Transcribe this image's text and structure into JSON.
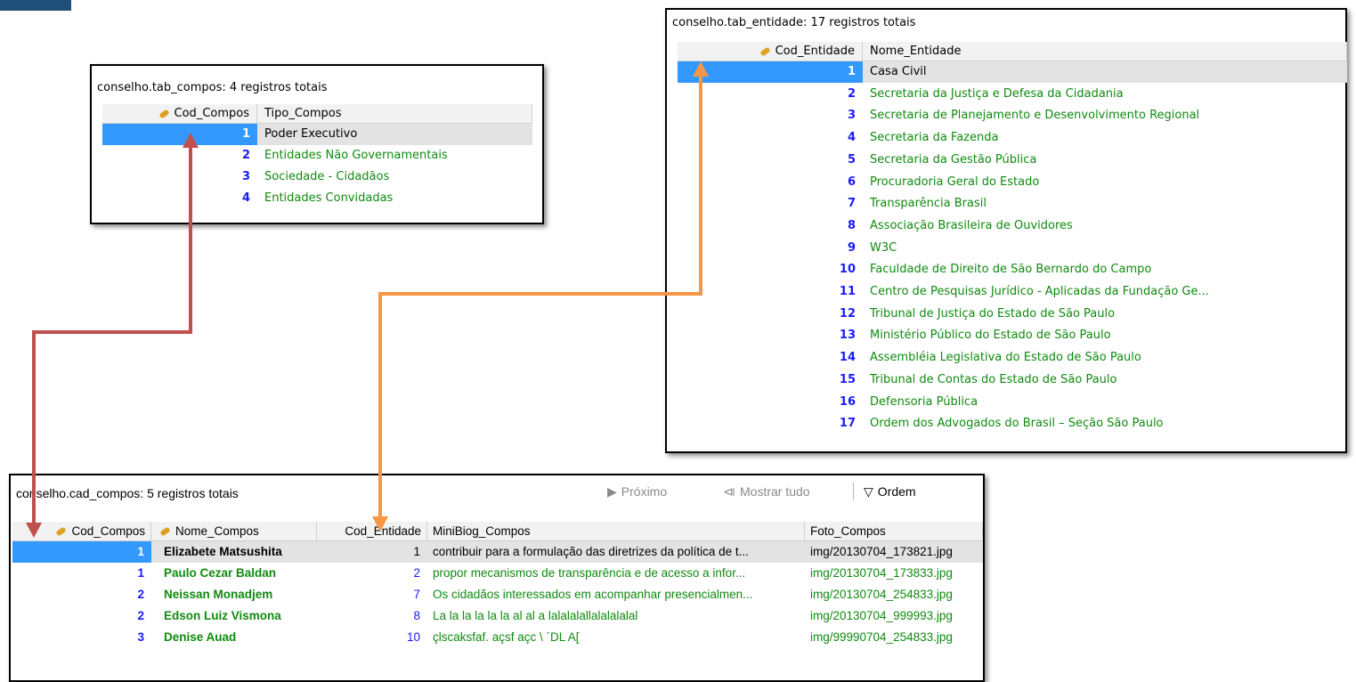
{
  "compos_table": {
    "title": "conselho.tab_compos: 4 registros totais",
    "columns": [
      "Cod_Compos",
      "Tipo_Compos"
    ],
    "rows": [
      {
        "cod": "1",
        "tipo": "Poder Executivo"
      },
      {
        "cod": "2",
        "tipo": "Entidades Não Governamentais"
      },
      {
        "cod": "3",
        "tipo": "Sociedade - Cidadãos"
      },
      {
        "cod": "4",
        "tipo": "Entidades Convidadas"
      }
    ]
  },
  "entidade_table": {
    "title": "conselho.tab_entidade: 17 registros totais",
    "columns": [
      "Cod_Entidade",
      "Nome_Entidade"
    ],
    "rows": [
      {
        "cod": "1",
        "nome": "Casa Civil"
      },
      {
        "cod": "2",
        "nome": "Secretaria da Justiça e Defesa da Cidadania"
      },
      {
        "cod": "3",
        "nome": "Secretaria de Planejamento e Desenvolvimento Regional"
      },
      {
        "cod": "4",
        "nome": "Secretaria da Fazenda"
      },
      {
        "cod": "5",
        "nome": "Secretaria da Gestão Pública"
      },
      {
        "cod": "6",
        "nome": "Procuradoria Geral do Estado"
      },
      {
        "cod": "7",
        "nome": "Transparência Brasil"
      },
      {
        "cod": "8",
        "nome": "Associação Brasileira de Ouvidores"
      },
      {
        "cod": "9",
        "nome": "W3C"
      },
      {
        "cod": "10",
        "nome": "Faculdade de Direito de São Bernardo do Campo"
      },
      {
        "cod": "11",
        "nome": "Centro de Pesquisas Jurídico - Aplicadas da Fundação Ge..."
      },
      {
        "cod": "12",
        "nome": "Tribunal de Justiça do Estado de São Paulo"
      },
      {
        "cod": "13",
        "nome": "Ministério Público do Estado de São Paulo"
      },
      {
        "cod": "14",
        "nome": "Assembléia Legislativa do Estado de São Paulo"
      },
      {
        "cod": "15",
        "nome": "Tribunal de Contas do Estado de São Paulo"
      },
      {
        "cod": "16",
        "nome": "Defensoria Pública"
      },
      {
        "cod": "17",
        "nome": "Ordem dos Advogados do Brasil – Seção São Paulo"
      }
    ]
  },
  "cad_table": {
    "title": "conselho.cad_compos: 5 registros totais",
    "toolbar": {
      "next_label": "Próximo",
      "show_all_label": "Mostrar tudo",
      "order_label": "Ordem"
    },
    "columns": [
      "Cod_Compos",
      "Nome_Compos",
      "Cod_Entidade",
      "MiniBiog_Compos",
      "Foto_Compos"
    ],
    "rows": [
      {
        "cod": "1",
        "nome": "Elizabete Matsushita",
        "ent": "1",
        "bio": "contribuir para a formulação das diretrizes da política de t...",
        "foto": "img/20130704_173821.jpg"
      },
      {
        "cod": "1",
        "nome": "Paulo Cezar Baldan",
        "ent": "2",
        "bio": "propor mecanismos de transparência e de acesso a infor...",
        "foto": "img/20130704_173833.jpg"
      },
      {
        "cod": "2",
        "nome": "Neissan Monadjem",
        "ent": "7",
        "bio": "Os cidadãos interessados em acompanhar presencialmen...",
        "foto": "img/20130704_254833.jpg"
      },
      {
        "cod": "2",
        "nome": "Edson Luiz Vismona",
        "ent": "8",
        "bio": "La la la la la la al al a lalalalallalalalalal",
        "foto": "img/20130704_999993.jpg"
      },
      {
        "cod": "3",
        "nome": "Denise Auad",
        "ent": "10",
        "bio": "çlscaksfaf. açsf açc \\ ´DL A[",
        "foto": "img/99990704_254833.jpg"
      }
    ]
  },
  "colors": {
    "selection": "#3399ff",
    "key_number": "#1a1aff",
    "text_green": "#108a10",
    "arrow_red": "#c0504d",
    "arrow_orange": "#f79646"
  }
}
